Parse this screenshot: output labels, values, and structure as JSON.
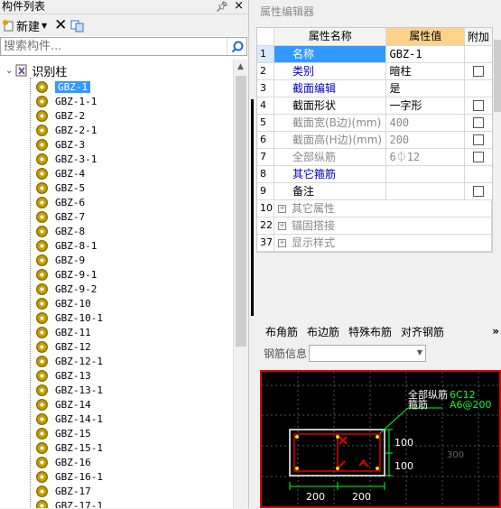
{
  "left_panel": {
    "title": "构件列表",
    "pin_icon": "pin-icon",
    "close_icon": "close-icon",
    "toolbar": {
      "new_label": "新建",
      "delete_icon": "delete-icon",
      "copy_icon": "copy-icon"
    },
    "search_placeholder": "搜索构件...",
    "tree": {
      "root_label": "识别柱",
      "items": [
        "GBZ-1",
        "GBZ-1-1",
        "GBZ-2",
        "GBZ-2-1",
        "GBZ-3",
        "GBZ-3-1",
        "GBZ-4",
        "GBZ-5",
        "GBZ-6",
        "GBZ-7",
        "GBZ-8",
        "GBZ-8-1",
        "GBZ-9",
        "GBZ-9-1",
        "GBZ-9-2",
        "GBZ-10",
        "GBZ-10-1",
        "GBZ-11",
        "GBZ-12",
        "GBZ-12-1",
        "GBZ-13",
        "GBZ-13-1",
        "GBZ-14",
        "GBZ-14-1",
        "GBZ-15",
        "GBZ-15-1",
        "GBZ-16",
        "GBZ-16-1",
        "GBZ-17",
        "GBZ-17-1"
      ],
      "selected": "GBZ-1"
    }
  },
  "right_panel": {
    "title": "属性编辑器",
    "grid": {
      "headers": {
        "name": "属性名称",
        "value": "属性值",
        "extra": "附加"
      },
      "rows": [
        {
          "num": "1",
          "name": "名称",
          "value": "GBZ-1",
          "style": "blue",
          "check": false
        },
        {
          "num": "2",
          "name": "类别",
          "value": "暗柱",
          "style": "blue",
          "check": true
        },
        {
          "num": "3",
          "name": "截面编辑",
          "value": "是",
          "style": "blue",
          "check": false
        },
        {
          "num": "4",
          "name": "截面形状",
          "value": "一字形",
          "style": "normal",
          "check": true
        },
        {
          "num": "5",
          "name": "截面宽(B边)(mm)",
          "value": "400",
          "style": "gray",
          "check": true
        },
        {
          "num": "6",
          "name": "截面高(H边)(mm)",
          "value": "200",
          "style": "gray",
          "check": true
        },
        {
          "num": "7",
          "name": "全部纵筋",
          "value": "6⏀12",
          "style": "gray",
          "check": true
        },
        {
          "num": "8",
          "name": "其它箍筋",
          "value": "",
          "style": "blue",
          "check": false
        },
        {
          "num": "9",
          "name": "备注",
          "value": "",
          "style": "normal",
          "check": true
        },
        {
          "num": "10",
          "name": "其它属性",
          "value": "",
          "style": "group",
          "check": false
        },
        {
          "num": "22",
          "name": "锚固搭接",
          "value": "",
          "style": "group",
          "check": false
        },
        {
          "num": "37",
          "name": "显示样式",
          "value": "",
          "style": "group",
          "check": false
        }
      ]
    },
    "bottom": {
      "tabs": [
        "布角筋",
        "布边筋",
        "特殊布筋",
        "对齐钢筋"
      ],
      "more_icon": "more-icon",
      "rebar_info_label": "钢筋信息",
      "rebar_info_value": "",
      "drawing": {
        "label_all": "全部纵筋",
        "label_stirrup": "箍筋",
        "value_all": "6C12",
        "value_stirrup": "A6@200",
        "dim_h1": "100",
        "dim_h2": "100",
        "dim_w1": "200",
        "dim_w2": "200",
        "faint_dim": "300"
      }
    }
  }
}
